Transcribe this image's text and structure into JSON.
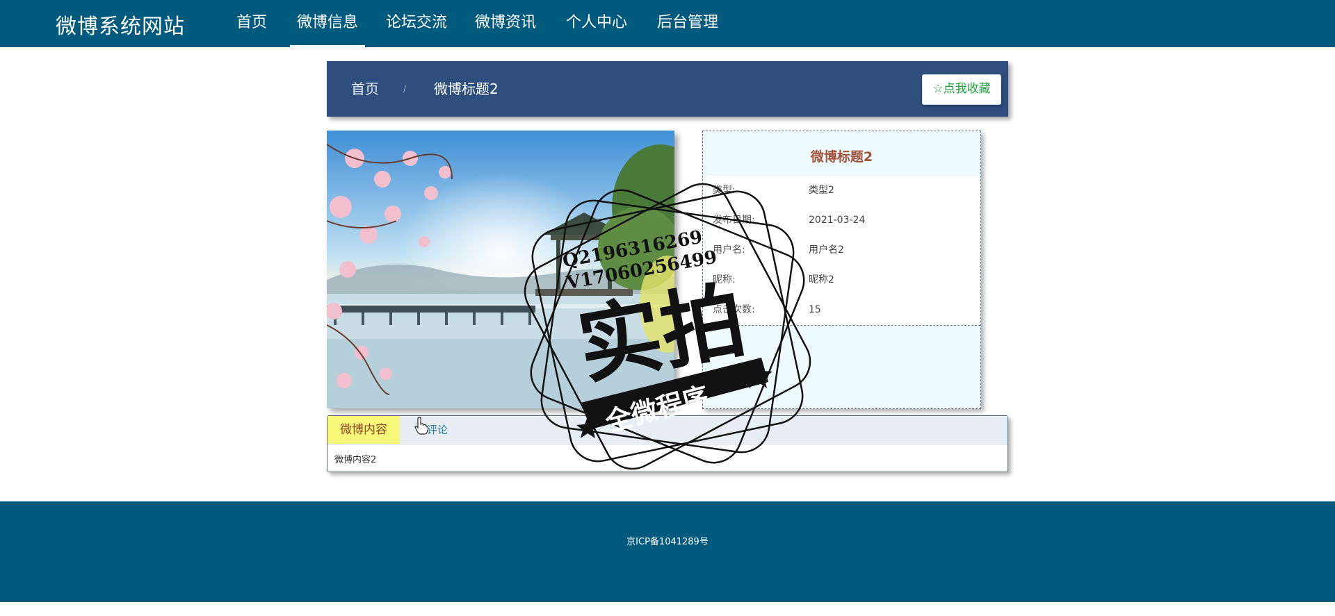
{
  "header": {
    "brand": "微博系统网站",
    "nav": [
      "首页",
      "微博信息",
      "论坛交流",
      "微博资讯",
      "个人中心",
      "后台管理"
    ],
    "active_index": 1
  },
  "breadcrumb": {
    "home": "首页",
    "separator": "/",
    "current": "微博标题2",
    "favorite_button": "☆点我收藏"
  },
  "detail": {
    "title": "微博标题2",
    "fields": [
      {
        "label": "类型:",
        "value": "类型2"
      },
      {
        "label": "发布日期:",
        "value": "2021-03-24"
      },
      {
        "label": "用户名:",
        "value": "用户名2"
      },
      {
        "label": "昵称:",
        "value": "昵称2"
      },
      {
        "label": "点击次数:",
        "value": "15"
      }
    ]
  },
  "tabs": {
    "items": [
      "微博内容",
      "评论"
    ],
    "active_index": 0,
    "content": "微博内容2"
  },
  "footer": {
    "text": "京ICP备1041289号"
  },
  "watermark": {
    "line1": "Q2196316269",
    "line2": "V17060256499",
    "main": "实拍",
    "ribbon": "全微程序"
  },
  "colors": {
    "nav_bg": "#005a7d",
    "breadcrumb_bg": "#2e4e7e",
    "title_accent": "#a2523c",
    "favorite_text": "#1fa33b",
    "active_tab_bg": "#f7f77a"
  },
  "icons": [
    "star-icon",
    "pointer-cursor-icon"
  ]
}
